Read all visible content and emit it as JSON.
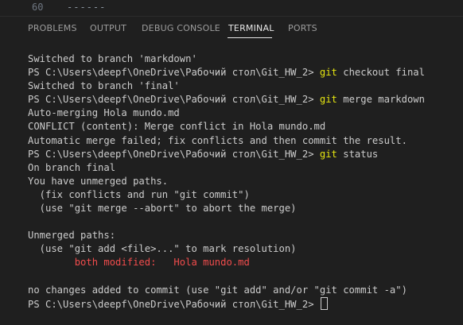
{
  "editor": {
    "line_number": "60",
    "line_text": "------"
  },
  "tabs": [
    {
      "label": "PROBLEMS",
      "active": false
    },
    {
      "label": "OUTPUT",
      "active": false
    },
    {
      "label": "DEBUG CONSOLE",
      "active": false
    },
    {
      "label": "TERMINAL",
      "active": true
    },
    {
      "label": "PORTS",
      "active": false
    }
  ],
  "terminal": {
    "prompt": "PS C:\\Users\\deepf\\OneDrive\\Рабочий стол\\Git_HW_2>",
    "lines": [
      {
        "text": "Switched to branch 'markdown'"
      },
      {
        "command_name": "git",
        "command_args": "checkout final"
      },
      {
        "text": "Switched to branch 'final'"
      },
      {
        "command_name": "git",
        "command_args": "merge markdown"
      },
      {
        "text": "Auto-merging Hola mundo.md"
      },
      {
        "text": "CONFLICT (content): Merge conflict in Hola mundo.md"
      },
      {
        "text": "Automatic merge failed; fix conflicts and then commit the result."
      },
      {
        "command_name": "git",
        "command_args": "status"
      },
      {
        "text": "On branch final"
      },
      {
        "text": "You have unmerged paths."
      },
      {
        "text": "  (fix conflicts and run \"git commit\")"
      },
      {
        "text": "  (use \"git merge --abort\" to abort the merge)"
      },
      {
        "text": ""
      },
      {
        "text": "Unmerged paths:"
      },
      {
        "text": "  (use \"git add <file>...\" to mark resolution)"
      },
      {
        "text": "        both modified:   Hola mundo.md",
        "style": "error"
      },
      {
        "text": ""
      },
      {
        "text": "no changes added to commit (use \"git add\" and/or \"git commit -a\")"
      },
      {
        "prompt_only": true
      }
    ]
  },
  "colors": {
    "background": "#1f1f1f",
    "text": "#cccccc",
    "command": "#e5e510",
    "error": "#f14c4c"
  }
}
